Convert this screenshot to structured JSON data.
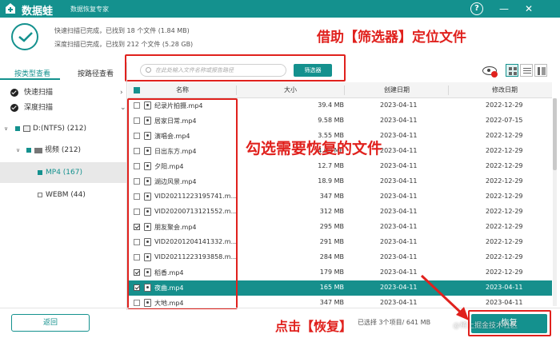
{
  "app": {
    "name": "数据蛙",
    "subtitle": "数据恢复专家",
    "help_glyph": "?",
    "minimize_glyph": "—",
    "close_glyph": "✕"
  },
  "scan": {
    "quick": "快速扫描已完成，已找到 18 个文件 (1.84 MB)",
    "deep": "深度扫描已完成，已找到 212 个文件 (5.28 GB)"
  },
  "annotations": {
    "filter": "借助【筛选器】定位文件",
    "select": "勾选需要恢复的文件",
    "click": "点击【恢复】"
  },
  "search": {
    "placeholder": "在此处输入文件名称或报告路径",
    "filter_button": "筛选器"
  },
  "view_tabs": [
    "按类型查看",
    "按路径查看"
  ],
  "tree": {
    "quick_scan": "快速扫描",
    "deep_scan": "深度扫描",
    "drive": "D:(NTFS) (212)",
    "video": "视频 (212)",
    "mp4": "MP4 (167)",
    "webm": "WEBM (44)"
  },
  "table": {
    "headers": [
      "名称",
      "大小",
      "创建日期",
      "修改日期"
    ],
    "rows": [
      {
        "name": "纪录片拍摄.mp4",
        "size": "39.4 MB",
        "created": "2023-04-11",
        "modified": "2022-12-29",
        "checked": false
      },
      {
        "name": "居家日常.mp4",
        "size": "9.58 MB",
        "created": "2023-04-11",
        "modified": "2022-07-15",
        "checked": false
      },
      {
        "name": "演唱会.mp4",
        "size": "3.55 MB",
        "created": "2023-04-11",
        "modified": "2022-12-29",
        "checked": false
      },
      {
        "name": "日出东方.mp4",
        "size": "4.00 MB",
        "created": "2023-04-11",
        "modified": "2022-12-29",
        "checked": false
      },
      {
        "name": "夕阳.mp4",
        "size": "12.7 MB",
        "created": "2023-04-11",
        "modified": "2022-12-29",
        "checked": false
      },
      {
        "name": "湖边风景.mp4",
        "size": "18.9 MB",
        "created": "2023-04-11",
        "modified": "2022-12-29",
        "checked": false
      },
      {
        "name": "VID20211223195741.m...",
        "size": "347 MB",
        "created": "2023-04-11",
        "modified": "2022-12-29",
        "checked": false
      },
      {
        "name": "VID20200713121552.m...",
        "size": "312 MB",
        "created": "2023-04-11",
        "modified": "2022-12-29",
        "checked": false
      },
      {
        "name": "朋友聚会.mp4",
        "size": "295 MB",
        "created": "2023-04-11",
        "modified": "2022-12-29",
        "checked": true
      },
      {
        "name": "VID20201204141332.m...",
        "size": "291 MB",
        "created": "2023-04-11",
        "modified": "2022-12-29",
        "checked": false
      },
      {
        "name": "VID20211223193858.m...",
        "size": "284 MB",
        "created": "2023-04-11",
        "modified": "2022-12-29",
        "checked": false
      },
      {
        "name": "稻香.mp4",
        "size": "179 MB",
        "created": "2023-04-11",
        "modified": "2022-12-29",
        "checked": true
      },
      {
        "name": "夜曲.mp4",
        "size": "165 MB",
        "created": "2023-04-11",
        "modified": "2023-04-11",
        "checked": true,
        "highlighted": true
      },
      {
        "name": "大地.mp4",
        "size": "347 MB",
        "created": "2023-04-11",
        "modified": "2023-04-11",
        "checked": false
      }
    ]
  },
  "bottom": {
    "back": "返回",
    "status": "已选择 3个项目/ 641 MB",
    "recover": "恢复",
    "watermark": "@稀土掘金技术社区"
  },
  "colors": {
    "accent": "#14918e",
    "annotation": "#e0211d"
  }
}
